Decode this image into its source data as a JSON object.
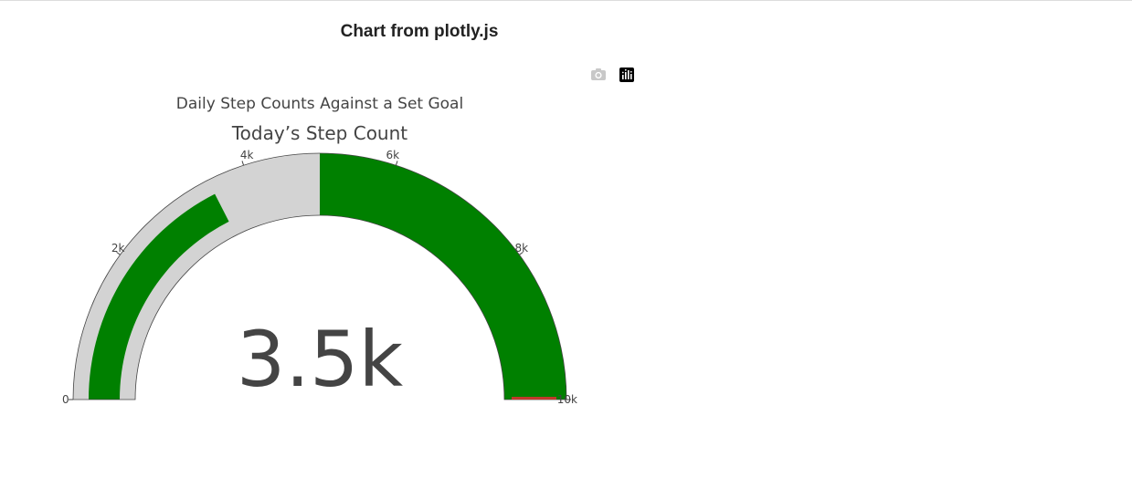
{
  "page": {
    "heading": "Chart from plotly.js"
  },
  "modebar": {
    "camera_icon": "camera-icon",
    "plotly_logo_icon": "plotly-logo-icon"
  },
  "chart_data": {
    "type": "gauge",
    "title": "Daily Step Counts Against a Set Goal",
    "gauge_title": "Today’s Step Count",
    "value": 3500,
    "value_label": "3.5k",
    "axis_range": [
      0,
      10000
    ],
    "ticks": [
      {
        "value": 0,
        "label": "0"
      },
      {
        "value": 2000,
        "label": "2k"
      },
      {
        "value": 4000,
        "label": "4k"
      },
      {
        "value": 6000,
        "label": "6k"
      },
      {
        "value": 8000,
        "label": "8k"
      },
      {
        "value": 10000,
        "label": "10k"
      }
    ],
    "steps": [
      {
        "range": [
          0,
          5000
        ],
        "color": "#d3d3d3"
      },
      {
        "range": [
          5000,
          10000
        ],
        "color": "#008000"
      }
    ],
    "bar_color": "#008000",
    "threshold": {
      "value": 10000,
      "color": "#c0392b"
    }
  }
}
